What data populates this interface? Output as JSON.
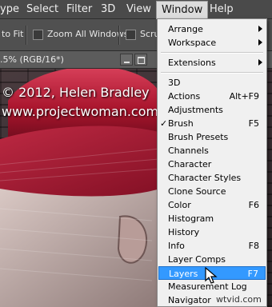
{
  "menubar": {
    "items": [
      "ype",
      "Select",
      "Filter",
      "3D",
      "View",
      "Window",
      "Help"
    ],
    "active_index": 5
  },
  "optionsbar": {
    "fit_label": "to Fit",
    "zoom_all_label": "Zoom All Windows",
    "scrubby_label": "Scru"
  },
  "document": {
    "tab_title": ".5% (RGB/16*)"
  },
  "artwork": {
    "watermark_line1": "© 2012, Helen Bradley",
    "watermark_line2": "www.projectwoman.com"
  },
  "window_menu": {
    "items": [
      {
        "label": "Arrange",
        "submenu": true
      },
      {
        "label": "Workspace",
        "submenu": true
      },
      {
        "separator": true
      },
      {
        "label": "Extensions",
        "submenu": true
      },
      {
        "separator": true
      },
      {
        "label": "3D"
      },
      {
        "label": "Actions",
        "shortcut": "Alt+F9"
      },
      {
        "label": "Adjustments"
      },
      {
        "label": "Brush",
        "shortcut": "F5",
        "checked": true
      },
      {
        "label": "Brush Presets"
      },
      {
        "label": "Channels"
      },
      {
        "label": "Character"
      },
      {
        "label": "Character Styles"
      },
      {
        "label": "Clone Source"
      },
      {
        "label": "Color",
        "shortcut": "F6"
      },
      {
        "label": "Histogram"
      },
      {
        "label": "History"
      },
      {
        "label": "Info",
        "shortcut": "F8"
      },
      {
        "label": "Layer Comps"
      },
      {
        "label": "Layers",
        "shortcut": "F7",
        "highlighted": true
      },
      {
        "label": "Measurement Log"
      },
      {
        "label": "Navigator"
      }
    ]
  },
  "credit": {
    "text": "wtvid.com"
  },
  "colors": {
    "highlight": "#3399ff",
    "menu_bg": "#f0f0f0",
    "menubar_bg": "#4a4a4a",
    "hat_red": "#b01830"
  }
}
